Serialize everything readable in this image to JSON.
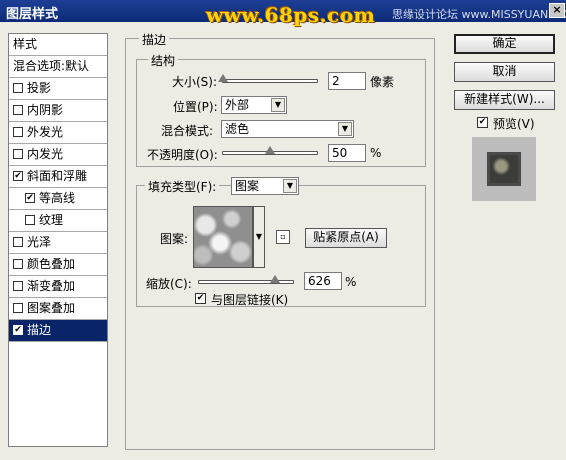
{
  "window": {
    "title": "图层样式",
    "watermark": "www.68ps.com",
    "watermark_sub": "思缘设计论坛 www.MISSYUAN.COM",
    "close_label": "×"
  },
  "stylelist": {
    "header": "样式",
    "blend_options": "混合选项:默认",
    "items": [
      {
        "label": "投影",
        "checked": false
      },
      {
        "label": "内阴影",
        "checked": false
      },
      {
        "label": "外发光",
        "checked": false
      },
      {
        "label": "内发光",
        "checked": false
      },
      {
        "label": "斜面和浮雕",
        "checked": true
      },
      {
        "label": "等高线",
        "checked": true,
        "indent": true
      },
      {
        "label": "纹理",
        "checked": false,
        "indent": true
      },
      {
        "label": "光泽",
        "checked": false
      },
      {
        "label": "颜色叠加",
        "checked": false
      },
      {
        "label": "渐变叠加",
        "checked": false
      },
      {
        "label": "图案叠加",
        "checked": false
      },
      {
        "label": "描边",
        "checked": true,
        "selected": true
      }
    ]
  },
  "stroke": {
    "group_title": "描边",
    "structure_title": "结构",
    "size_label": "大小(S):",
    "size_value": "2",
    "size_unit": "像素",
    "position_label": "位置(P):",
    "position_value": "外部",
    "blend_label": "混合模式:",
    "blend_value": "滤色",
    "opacity_label": "不透明度(O):",
    "opacity_value": "50",
    "opacity_unit": "%",
    "fill_type_label": "填充类型(F):",
    "fill_type_value": "图案",
    "pattern_label": "图案:",
    "snap_button": "贴紧原点(A)",
    "scale_label": "缩放(C):",
    "scale_value": "626",
    "scale_unit": "%",
    "link_label": "与图层链接(K)",
    "link_checked": true,
    "size_slider_fraction": 0.01,
    "opacity_slider_fraction": 0.5,
    "scale_slider_fraction": 0.8
  },
  "buttons": {
    "ok": "确定",
    "cancel": "取消",
    "new_style": "新建样式(W)...",
    "preview_label": "预览(V)",
    "preview_checked": true
  }
}
